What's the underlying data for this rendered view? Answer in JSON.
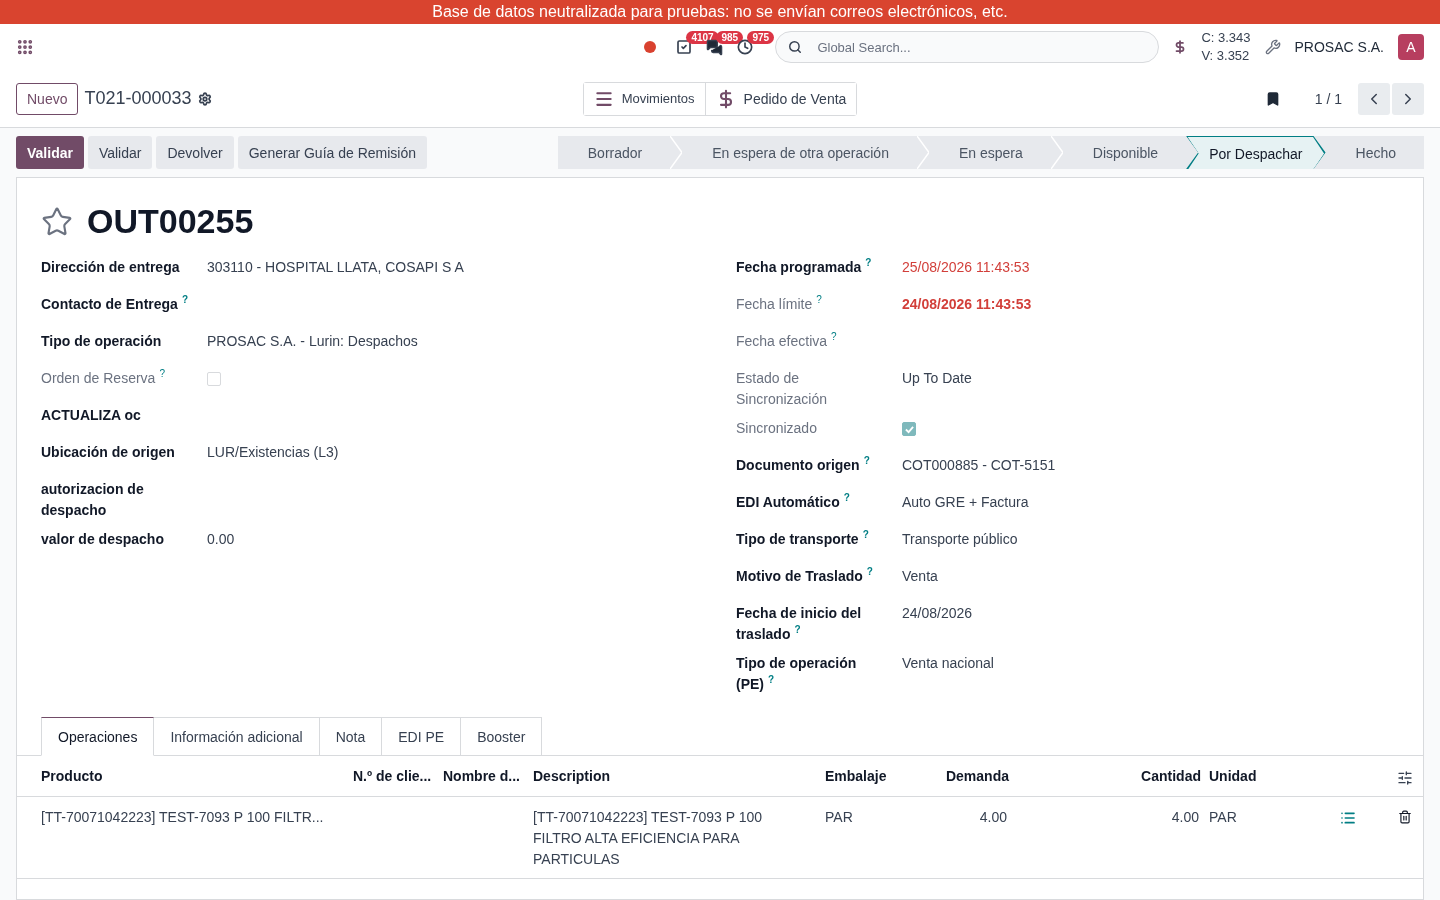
{
  "banner": "Base de datos neutralizada para pruebas: no se envían correos electrónicos, etc.",
  "navbar": {
    "badges": [
      {
        "kind": "activities",
        "count": "4107"
      },
      {
        "kind": "messages",
        "count": "985"
      },
      {
        "kind": "timer",
        "count": "975"
      }
    ],
    "search": {
      "placeholder": "Global Search..."
    },
    "rates": [
      "C: 3.343",
      "V: 3.352"
    ],
    "company": "PROSAC S.A.",
    "avatar": "A"
  },
  "control_panel": {
    "new_button": "Nuevo",
    "record_name": "T021-000033",
    "smart_buttons": [
      {
        "kind": "list",
        "label": "Movimientos"
      },
      {
        "kind": "dollar",
        "label": "Pedido de Venta"
      }
    ],
    "pager": "1 / 1"
  },
  "actions": [
    {
      "label": "Validar",
      "primary": true
    },
    {
      "label": "Validar",
      "primary": false
    },
    {
      "label": "Devolver",
      "primary": false
    },
    {
      "label": "Generar Guía de Remisión",
      "primary": false
    }
  ],
  "stages": [
    {
      "label": "Borrador",
      "selected": false
    },
    {
      "label": "En espera de otra operación",
      "selected": false
    },
    {
      "label": "En espera",
      "selected": false
    },
    {
      "label": "Disponible",
      "selected": false
    },
    {
      "label": "Por Despachar",
      "selected": true
    },
    {
      "label": "Hecho",
      "selected": false
    }
  ],
  "record": {
    "title": "OUT00255",
    "favorite": false,
    "left_fields": [
      {
        "label": "Dirección de entrega",
        "muted": false,
        "kind": "text",
        "value": "303110 - HOSPITAL LLATA, COSAPI S A"
      },
      {
        "label": "Contacto de Entrega",
        "muted": false,
        "help": "?",
        "kind": "empty"
      },
      {
        "label": "Tipo de operación",
        "muted": false,
        "kind": "text",
        "value": "PROSAC S.A. - Lurin: Despachos"
      },
      {
        "label": "Orden de Reserva",
        "muted": true,
        "help": "?",
        "kind": "checkbox",
        "checked": false
      },
      {
        "label": "ACTUALIZA oc",
        "muted": false,
        "kind": "empty"
      },
      {
        "label": "Ubicación de origen",
        "muted": false,
        "kind": "text",
        "value": "LUR/Existencias (L3)"
      },
      {
        "label": "autorizacion de despacho",
        "muted": false,
        "kind": "empty"
      },
      {
        "label": "valor de despacho",
        "muted": false,
        "kind": "text",
        "value": "0.00"
      }
    ],
    "right_fields": [
      {
        "label": "Fecha programada",
        "muted": false,
        "help": "?",
        "kind": "date",
        "value": "25/08/2026 11:43:53",
        "overdue": true,
        "bold": false
      },
      {
        "label": "Fecha límite",
        "muted": true,
        "help": "?",
        "kind": "date",
        "value": "24/08/2026 11:43:53",
        "overdue": true,
        "bold": true
      },
      {
        "label": "Fecha efectiva",
        "muted": true,
        "help": "?",
        "kind": "empty"
      },
      {
        "label": "Estado de Sincronización",
        "muted": true,
        "kind": "text",
        "value": "Up To Date"
      },
      {
        "label": "Sincronizado",
        "muted": true,
        "kind": "checkbox",
        "checked": true
      },
      {
        "label": "Documento origen",
        "muted": false,
        "help": "?",
        "kind": "text",
        "value": "COT000885 - COT-5151"
      },
      {
        "label": "EDI Automático",
        "muted": false,
        "help": "?",
        "kind": "text",
        "value": "Auto GRE + Factura"
      },
      {
        "label": "Tipo de transporte",
        "muted": false,
        "help": "?",
        "kind": "text",
        "value": "Transporte público"
      },
      {
        "label": "Motivo de Traslado",
        "muted": false,
        "help": "?",
        "kind": "text",
        "value": "Venta"
      },
      {
        "label": "Fecha de inicio del traslado",
        "muted": false,
        "help": "?",
        "kind": "text",
        "value": "24/08/2026"
      },
      {
        "label": "Tipo de operación (PE)",
        "muted": false,
        "help": "?",
        "kind": "text",
        "value": "Venta nacional"
      }
    ]
  },
  "tabs": [
    {
      "label": "Operaciones",
      "selected": true
    },
    {
      "label": "Información adicional",
      "selected": false
    },
    {
      "label": "Nota",
      "selected": false
    },
    {
      "label": "EDI PE",
      "selected": false
    },
    {
      "label": "Booster",
      "selected": false
    }
  ],
  "table": {
    "columns": [
      {
        "label": "Producto",
        "kind": "text"
      },
      {
        "label": "N.º de clie...",
        "kind": "text"
      },
      {
        "label": "Nombre d...",
        "kind": "text"
      },
      {
        "label": "Description",
        "kind": "text"
      },
      {
        "label": "Embalaje",
        "kind": "text"
      },
      {
        "label": "Demanda",
        "kind": "number"
      },
      {
        "label": "Cantidad",
        "kind": "number"
      },
      {
        "label": "Unidad",
        "kind": "text"
      }
    ],
    "rows": [
      {
        "cells": [
          "[TT-70071042223] TEST-7093 P 100 FILTR...",
          "",
          "",
          "[TT-70071042223] TEST-7093 P 100 FILTRO ALTA EFICIENCIA PARA PARTICULAS",
          "PAR",
          "4.00",
          "4.00",
          "PAR"
        ]
      }
    ]
  }
}
